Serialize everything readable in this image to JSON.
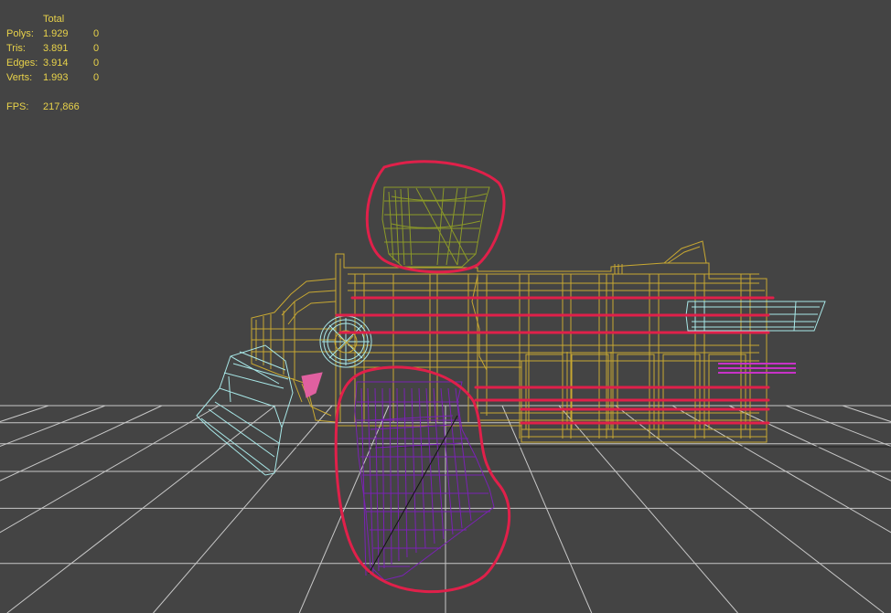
{
  "stats": {
    "header": "Total",
    "rows": [
      {
        "label": "Polys:",
        "total": "1.929",
        "selected": "0"
      },
      {
        "label": "Tris:",
        "total": "3.891",
        "selected": "0"
      },
      {
        "label": "Edges:",
        "total": "3.914",
        "selected": "0"
      },
      {
        "label": "Verts:",
        "total": "1.993",
        "selected": "0"
      }
    ],
    "fps_label": "FPS:",
    "fps_value": "217,866"
  },
  "colors": {
    "background": "#444444",
    "stats_text": "#e8d24a",
    "grid": "#c8c8c8",
    "body_wire": "#c8a832",
    "top_part_wire": "#8c9a28",
    "blade_wire": "#7a22b4",
    "trigger_wire": "#a8e8e8",
    "highlight": "#e0204a",
    "accent_pink": "#e060a0"
  }
}
